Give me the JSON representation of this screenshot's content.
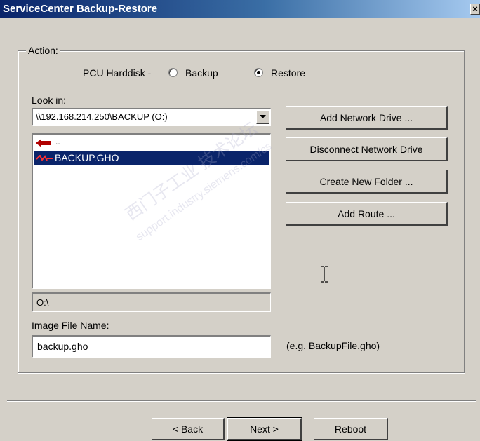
{
  "window": {
    "title": "ServiceCenter Backup-Restore",
    "close_glyph": "×"
  },
  "group": {
    "label": "Action:"
  },
  "pcu": {
    "label": "PCU Harddisk -",
    "option_backup": "Backup",
    "option_restore": "Restore",
    "selected": "Restore"
  },
  "look_in": {
    "label": "Look in:",
    "value": "\\\\192.168.214.250\\BACKUP (O:)"
  },
  "file_list": {
    "items": [
      {
        "label": "..",
        "icon": "up-arrow-icon",
        "selected": false
      },
      {
        "label": "BACKUP.GHO",
        "icon": "ghost-file-icon",
        "selected": true
      }
    ]
  },
  "path_display": "O:\\",
  "image_file": {
    "label": "Image File Name:",
    "value": "backup.gho",
    "hint": "(e.g. BackupFile.gho)"
  },
  "side_buttons": {
    "add_network_drive": "Add Network Drive ...",
    "disconnect_network_drive": "Disconnect Network Drive",
    "create_new_folder": "Create New Folder ...",
    "add_route": "Add Route ..."
  },
  "footer": {
    "back": "< Back",
    "next": "Next >",
    "reboot": "Reboot"
  },
  "watermark": {
    "line1": "西门子工业  技术论坛",
    "line2": "support.industry.siemens.com/cs"
  },
  "colors": {
    "title_start": "#0a246a",
    "title_end": "#a6caf0",
    "face": "#d4d0c8",
    "selection": "#0a246a",
    "arrow": "#b00000"
  }
}
